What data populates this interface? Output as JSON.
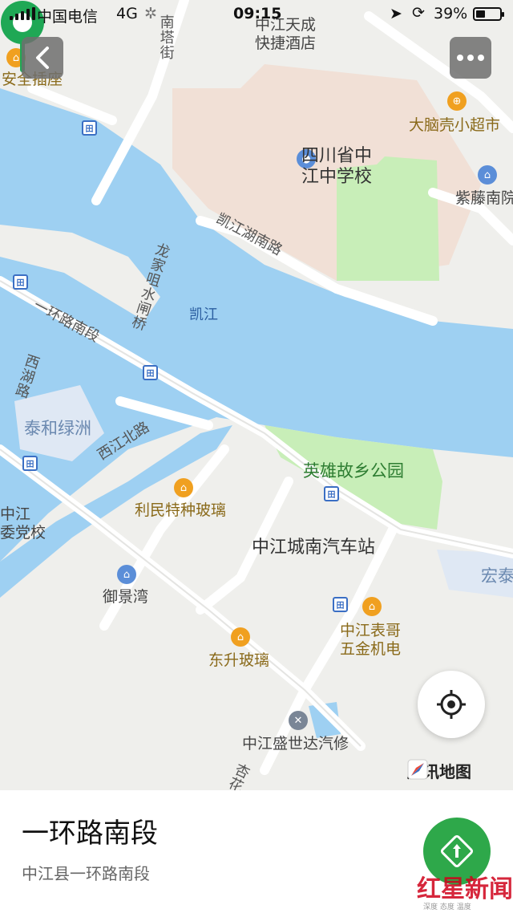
{
  "status_bar": {
    "carrier": "中国电信",
    "network": "4G",
    "time": "09:15",
    "battery": "39%",
    "battery_level": 0.39
  },
  "map": {
    "labels": {
      "hotel": "中江天成\n快捷酒店",
      "socket": "安全插座",
      "supermarket": "大脑壳小超市",
      "school": "四川省中\n江中学校",
      "zitengnan": "紫藤南院",
      "road_nanta": "南塔街",
      "road_kaijiang": "凯江湖南路",
      "bridge": "龙家咀水闸桥",
      "river": "凯江",
      "road_yihuan": "一环路南段",
      "road_xihu": "西湖路",
      "taihe": "泰和绿洲",
      "road_xijiang": "西江北路",
      "park": "英雄故乡公园",
      "limin": "利民特种玻璃",
      "party_school": "中江\n委党校",
      "bus_station": "中江城南汽车站",
      "hong": "宏泰",
      "yujing": "御景湾",
      "biaoge": "中江表哥\n五金机电",
      "dongsheng": "东升玻璃",
      "shengshida": "中江盛世达汽修",
      "road_bottom": "杏花"
    },
    "brand": "腾讯地图"
  },
  "place": {
    "name": "一环路南段",
    "address": "中江县一环路南段"
  },
  "watermark": {
    "main": "红星新闻",
    "sub": "深度 态度 温度"
  },
  "icons": {
    "back": "chevron-left-icon",
    "more": "more-dots-icon",
    "locate": "crosshair-icon",
    "navigate": "navigate-arrow-icon",
    "pin": "location-pin-icon"
  },
  "colors": {
    "water": "#9ed0f2",
    "park": "#c8eeb8",
    "school_area": "#f1e0d6",
    "pin": "#1fa855",
    "nav_button": "#2ea84a"
  }
}
